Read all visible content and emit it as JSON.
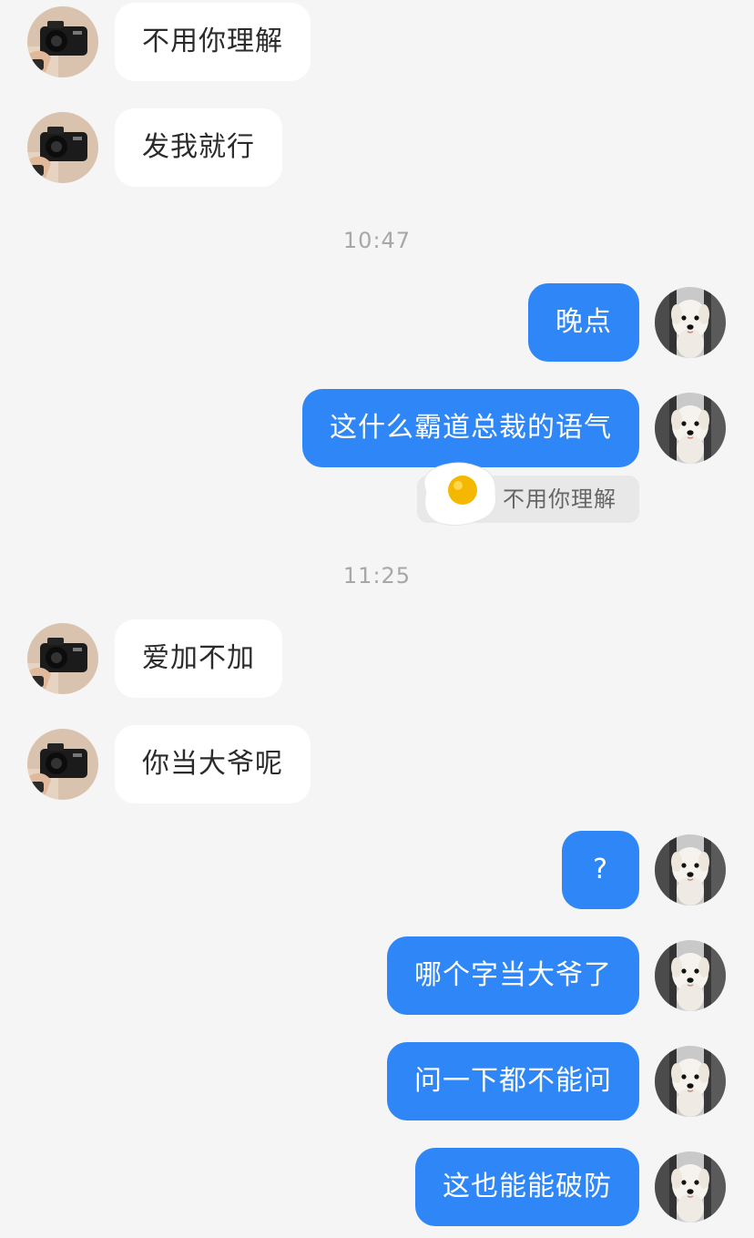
{
  "conversation": {
    "messages": [
      {
        "side": "left",
        "text": "不用你理解"
      },
      {
        "side": "left",
        "text": "发我就行"
      },
      {
        "side": "right",
        "text": "晚点"
      },
      {
        "side": "right",
        "text": "这什么霸道总裁的语气"
      },
      {
        "side": "left",
        "text": "爱加不加"
      },
      {
        "side": "left",
        "text": "你当大爷呢"
      },
      {
        "side": "right",
        "text": "?"
      },
      {
        "side": "right",
        "text": "哪个字当大爷了"
      },
      {
        "side": "right",
        "text": "问一下都不能问"
      },
      {
        "side": "right",
        "text": "这也能能破防"
      }
    ],
    "timestamps": [
      "10:47",
      "11:25"
    ],
    "quote": {
      "text": "不用你理解",
      "sticker_icon": "fried-egg-icon"
    }
  },
  "avatars": {
    "contact": "camera-avatar-icon",
    "self": "white-dog-avatar-icon"
  },
  "colors": {
    "background": "#f5f5f5",
    "incoming_bubble": "#ffffff",
    "outgoing_bubble": "#2f86f6",
    "timestamp": "#a7a7a7"
  }
}
